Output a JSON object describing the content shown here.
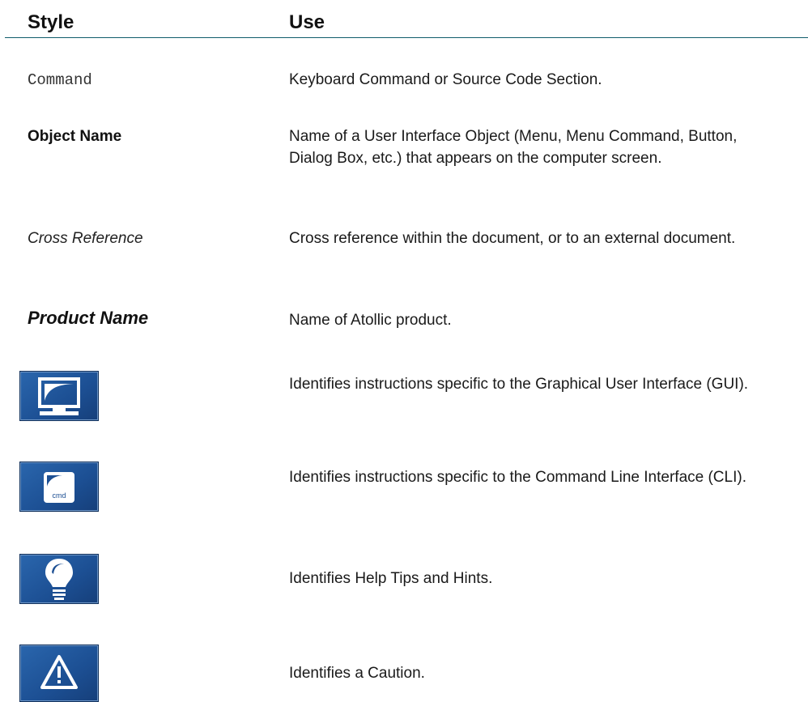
{
  "table": {
    "headers": {
      "style": "Style",
      "use": "Use"
    },
    "rows": [
      {
        "style": "Command",
        "use": "Keyboard Command or Source Code Section."
      },
      {
        "style": "Object Name",
        "use": "Name of a User Interface Object (Menu, Menu Command, Button, Dialog Box, etc.) that appears on the computer screen."
      },
      {
        "style": "Cross Reference",
        "use": "Cross reference within the document, or to an external document."
      },
      {
        "style": "Product Name",
        "use": "Name of Atollic product."
      },
      {
        "icon": "gui-monitor-icon",
        "use": "Identifies instructions specific to the Graphical User Interface (GUI)."
      },
      {
        "icon": "cli-cmd-icon",
        "icon_text": "cmd",
        "use": "Identifies instructions specific to the Command Line Interface (CLI)."
      },
      {
        "icon": "lightbulb-tip-icon",
        "use": "Identifies Help Tips and Hints."
      },
      {
        "icon": "warning-caution-icon",
        "use": "Identifies a Caution."
      }
    ]
  },
  "colors": {
    "rule": "#0f5c6b",
    "icon_bg": "#1c4f93",
    "icon_fg": "#ffffff"
  }
}
